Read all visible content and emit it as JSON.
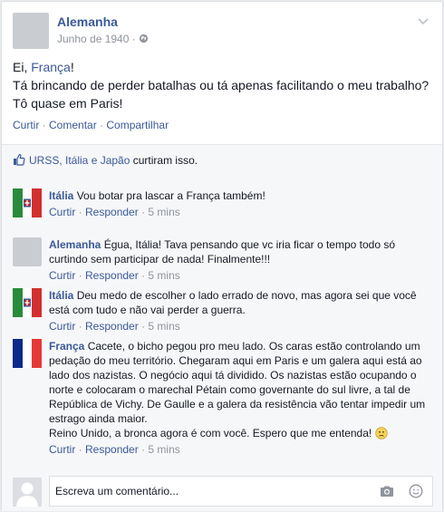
{
  "post": {
    "author": "Alemanha",
    "date": "Junho de 1940",
    "separator": "·",
    "line1_prefix": "Ei, ",
    "line1_link": "França",
    "line1_suffix": "!",
    "line2": "Tá brincando de perder batalhas ou tá apenas facilitando o meu trabalho?",
    "line3": "Tô quase em Paris!",
    "actions": {
      "like": "Curtir",
      "comment": "Comentar",
      "share": "Compartilhar",
      "sep": " · "
    }
  },
  "likes": {
    "names": "URSS, Itália e Japão",
    "suffix": " curtiram isso."
  },
  "comments": [
    {
      "name": "Itália",
      "text": "Vou botar pra lascar a França também!",
      "like": "Curtir",
      "reply": "Responder",
      "time": "5 mins"
    },
    {
      "name": "Alemanha",
      "text": "Égua, Itália! Tava pensando que vc iria ficar o tempo todo só curtindo sem participar de nada! Finalmente!!!",
      "like": "Curtir",
      "reply": "Responder",
      "time": "5 mins"
    },
    {
      "name": "Itália",
      "text": "Deu medo de escolher o lado errado de novo, mas agora sei que você está com tudo e não vai perder a guerra.",
      "like": "Curtir",
      "reply": "Responder",
      "time": "5 mins"
    },
    {
      "name": "França",
      "text": "Cacete, o bicho pegou pro meu lado. Os caras estão controlando um pedação do meu território. Chegaram aqui em Paris e um galera aqui está ao lado dos nazistas. O negócio aqui tá dividido. Os nazistas estão ocupando o norte e colocaram o marechal Pétain como governante do sul livre, a tal de República de Vichy. De Gaulle e a galera da resistência vão tentar impedir um estrago ainda maior.",
      "text2": "Reino Unido, a bronca agora é com você. Espero que me entenda!",
      "like": "Curtir",
      "reply": "Responder",
      "time": "5 mins"
    }
  ],
  "reply": {
    "placeholder": "Escreva um comentário..."
  },
  "icons": {
    "chevron": "chevron-down-icon",
    "globe": "globe-icon",
    "like": "like-thumb-icon",
    "camera": "camera-icon",
    "emoji": "emoji-icon",
    "sad": "sad-face-icon"
  },
  "colors": {
    "link": "#3b5998",
    "meta": "#90949c",
    "bg": "#f6f7f9"
  }
}
